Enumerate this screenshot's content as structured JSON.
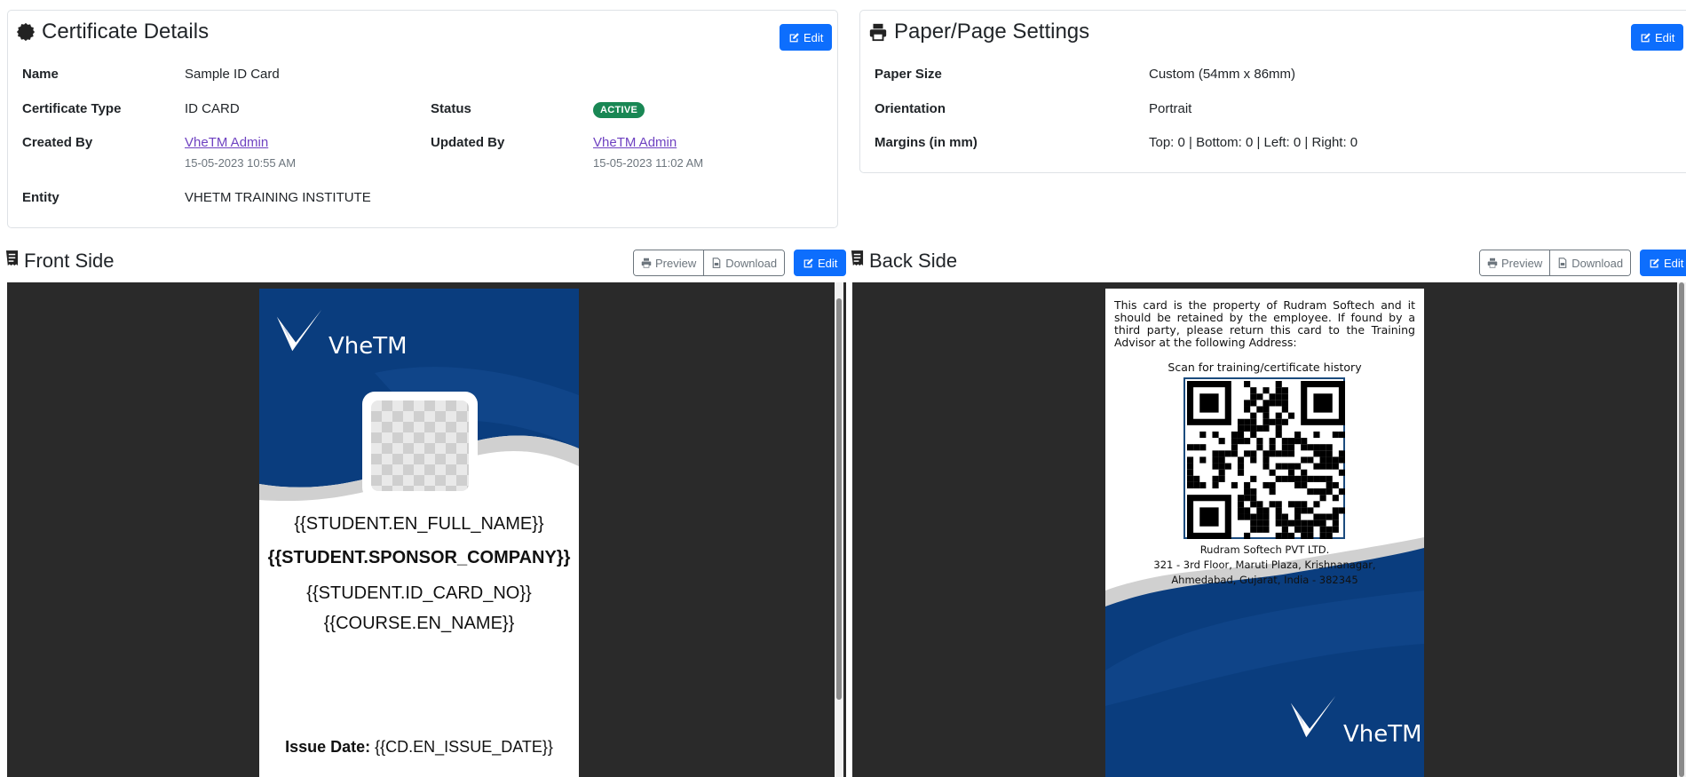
{
  "certificate_details": {
    "title": "Certificate Details",
    "edit_label": "Edit",
    "fields": {
      "name_label": "Name",
      "name_value": "Sample ID Card",
      "type_label": "Certificate Type",
      "type_value": "ID CARD",
      "status_label": "Status",
      "status_value": "ACTIVE",
      "created_label": "Created By",
      "created_by": "VheTM Admin",
      "created_at": "15-05-2023 10:55 AM",
      "updated_label": "Updated By",
      "updated_by": "VheTM Admin",
      "updated_at": "15-05-2023 11:02 AM",
      "entity_label": "Entity",
      "entity_value": "VHETM TRAINING INSTITUTE"
    }
  },
  "paper_settings": {
    "title": "Paper/Page Settings",
    "edit_label": "Edit",
    "paper_size_label": "Paper Size",
    "paper_size_value": "Custom (54mm x 86mm)",
    "orientation_label": "Orientation",
    "orientation_value": "Portrait",
    "margins_label": "Margins (in mm)",
    "margins_value": "Top: 0 | Bottom: 0 | Left: 0 | Right: 0"
  },
  "front_side": {
    "title": "Front Side",
    "preview_label": "Preview",
    "download_label": "Download",
    "edit_label": "Edit",
    "logo_text": "VheTM",
    "full_name": "{{STUDENT.EN_FULL_NAME}}",
    "sponsor_company": "{{STUDENT.SPONSOR_COMPANY}}",
    "id_card_no": "{{STUDENT.ID_CARD_NO}}",
    "course_name": "{{COURSE.EN_NAME}}",
    "issue_date_label": "Issue Date:",
    "issue_date_value": "{{CD.EN_ISSUE_DATE}}"
  },
  "back_side": {
    "title": "Back Side",
    "preview_label": "Preview",
    "download_label": "Download",
    "edit_label": "Edit",
    "notice": "This card is the property of Rudram Softech and it should be retained by the employee. If found by a third party, please return this card to the Training Advisor at the following Address:",
    "scan_caption": "Scan for training/certificate history",
    "company_name": "Rudram Softech PVT LTD.",
    "address_line1": "321 - 3rd Floor, Maruti Plaza, Krishnanagar,",
    "address_line2": "Ahmedabad, Gujarat, India - 382345",
    "logo_text": "VheTM"
  },
  "colors": {
    "primary": "#0d6efd",
    "success": "#198754",
    "card_navy": "#0a3d7e",
    "viewer_bg": "#2a2a2a"
  }
}
